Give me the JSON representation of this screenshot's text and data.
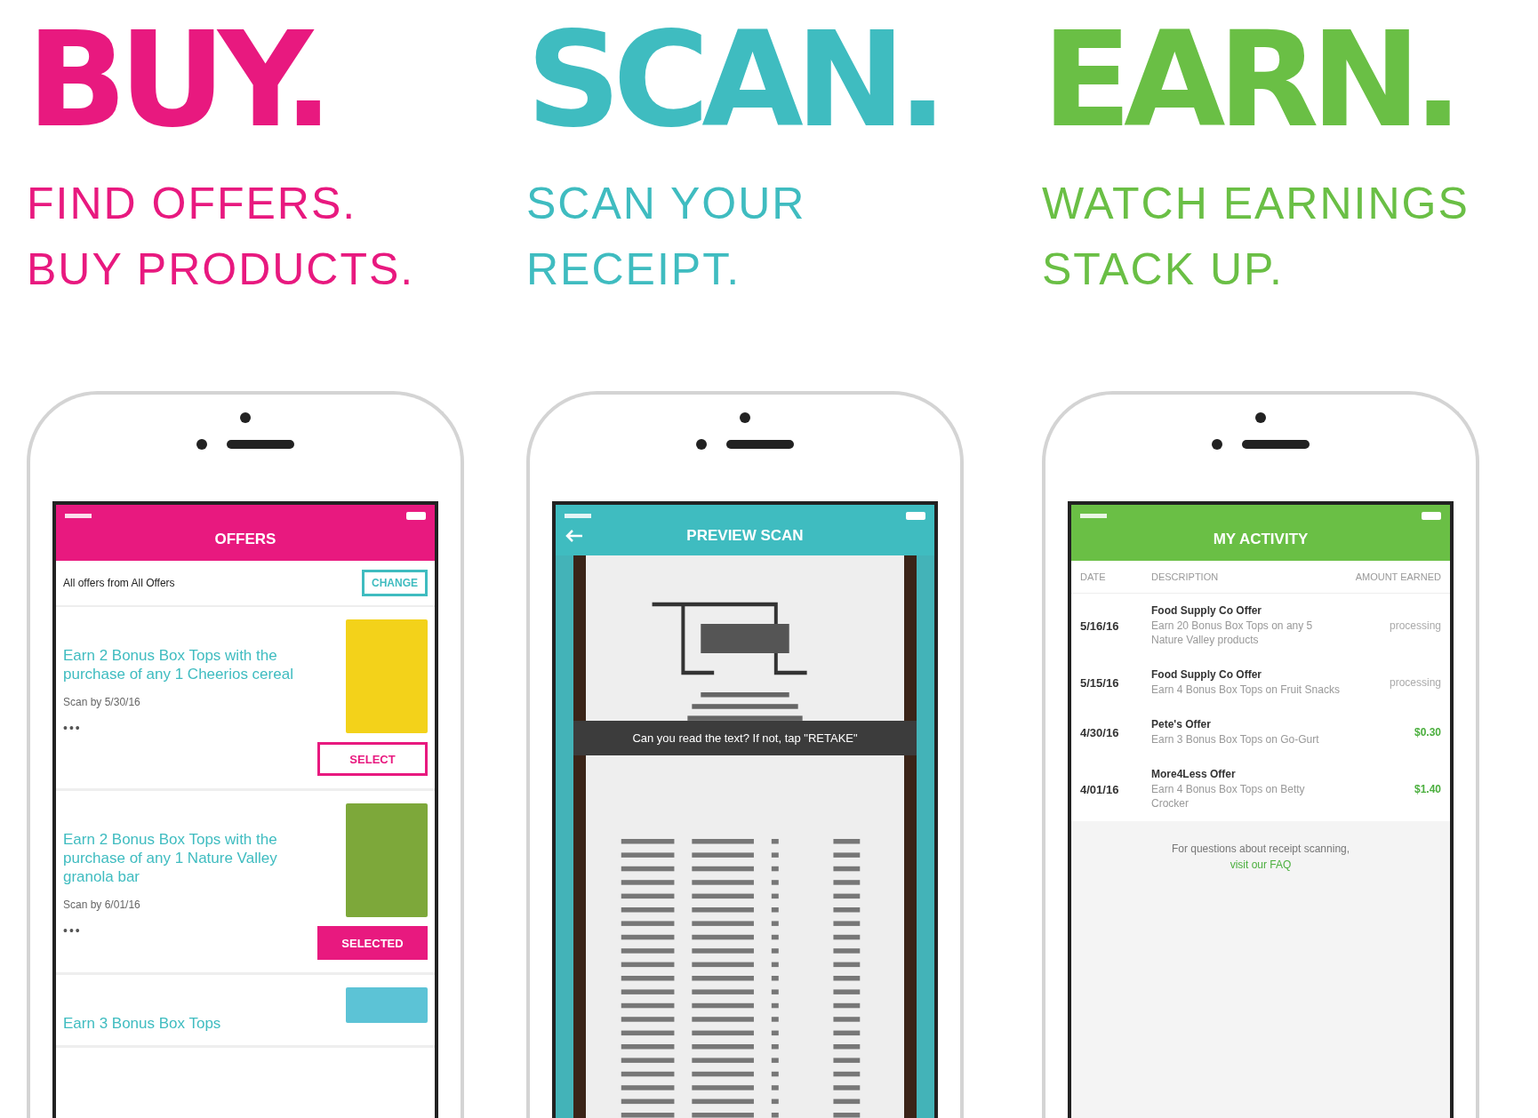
{
  "columns": [
    {
      "kind": "offers",
      "color": "#e8197f",
      "headline": "BUY.",
      "tagline": [
        "FIND OFFERS.",
        "BUY PRODUCTS."
      ],
      "screen": {
        "title": "OFFERS",
        "filter_text": "All offers from All Offers",
        "filter_button": "CHANGE",
        "offers": [
          {
            "text": "Earn 2 Bonus Box Tops with the purchase of any 1 Cheerios cereal",
            "scan_by": "Scan by 5/30/16",
            "more": "•••",
            "button": "SELECT",
            "selected": false
          },
          {
            "text": "Earn 2 Bonus Box Tops with the purchase of any 1 Nature Valley granola bar",
            "scan_by": "Scan by 6/01/16",
            "more": "•••",
            "button": "SELECTED",
            "selected": true
          },
          {
            "text": "Earn 3 Bonus Box Tops"
          }
        ]
      }
    },
    {
      "kind": "scan",
      "color": "#3fbcc0",
      "headline": "SCAN.",
      "tagline": [
        "SCAN YOUR",
        "RECEIPT."
      ],
      "screen": {
        "title": "PREVIEW SCAN",
        "prompt": "Can you read the text? If not, tap \"RETAKE\""
      }
    },
    {
      "kind": "activity",
      "color": "#6abf45",
      "headline": "EARN.",
      "tagline": [
        "WATCH EARNINGS",
        "STACK UP."
      ],
      "screen": {
        "title": "MY ACTIVITY",
        "headers": [
          "DATE",
          "DESCRIPTION",
          "AMOUNT EARNED"
        ],
        "rows": [
          {
            "date": "5/16/16",
            "title": "Food Supply Co Offer",
            "description": "Earn 20 Bonus Box Tops on any 5 Nature Valley products",
            "amount": "processing",
            "kind": "pending"
          },
          {
            "date": "5/15/16",
            "title": "Food Supply Co Offer",
            "description": "Earn 4 Bonus Box Tops on Fruit Snacks",
            "amount": "processing",
            "kind": "pending"
          },
          {
            "date": "4/30/16",
            "title": "Pete's Offer",
            "description": "Earn 3 Bonus Box Tops on Go-Gurt",
            "amount": "$0.30",
            "kind": "earned"
          },
          {
            "date": "4/01/16",
            "title": "More4Less Offer",
            "description": "Earn 4 Bonus Box Tops on Betty Crocker",
            "amount": "$1.40",
            "kind": "earned"
          }
        ],
        "footer": "For questions about receipt scanning,",
        "footer_link": "visit our FAQ"
      }
    }
  ]
}
